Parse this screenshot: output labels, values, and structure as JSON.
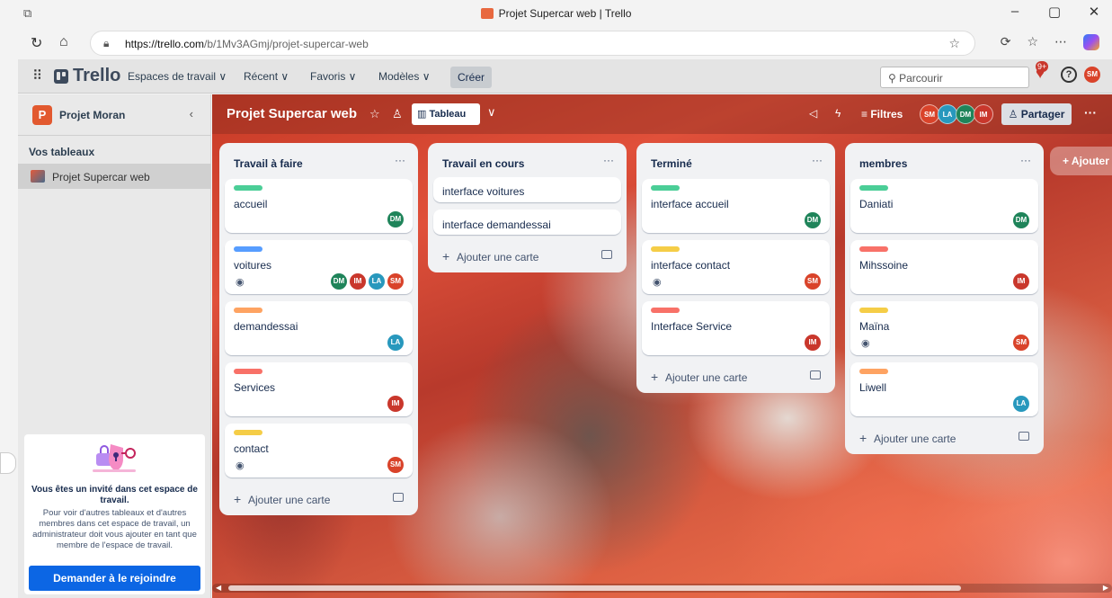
{
  "window": {
    "title": "Projet Supercar web | Trello",
    "minimize": "–",
    "restore": "▢",
    "close": "✕"
  },
  "browser": {
    "url_domain": "https://trello.com",
    "url_path": "/b/1Mv3AGmj/projet-supercar-web"
  },
  "header": {
    "logo": "Trello",
    "menus": [
      "Espaces de travail ∨",
      "Récent ∨",
      "Favoris ∨",
      "Modèles ∨"
    ],
    "create": "Créer",
    "search_placeholder": "Parcourir",
    "notif_count": "9+",
    "user_initials": "SM"
  },
  "sidebar": {
    "workspace_initial": "P",
    "workspace_name": "Projet Moran",
    "section": "Vos tableaux",
    "board": "Projet Supercar web",
    "invite": {
      "title": "Vous êtes un invité dans cet espace de travail.",
      "text": "Pour voir d'autres tableaux et d'autres membres dans cet espace de travail, un administrateur doit vous ajouter en tant que membre de l'espace de travail.",
      "button": "Demander à le rejoindre"
    }
  },
  "board": {
    "title": "Projet Supercar web",
    "view": "Tableau",
    "filters": "Filtres",
    "members": [
      "SM",
      "LA",
      "DM",
      "IM"
    ],
    "share": "Partager",
    "add_list": "+ Ajouter",
    "add_card": "Ajouter une carte",
    "lists": [
      {
        "title": "Travail à faire",
        "cards": [
          {
            "title": "accueil",
            "label": "#4bce97",
            "members": [
              "DM"
            ],
            "watch": false
          },
          {
            "title": "voitures",
            "label": "#579dff",
            "members": [
              "DM",
              "IM",
              "LA",
              "SM"
            ],
            "watch": true
          },
          {
            "title": "demandessai",
            "label": "#fea362",
            "members": [
              "LA"
            ],
            "watch": false
          },
          {
            "title": "Services",
            "label": "#f87168",
            "members": [
              "IM"
            ],
            "watch": false
          },
          {
            "title": "contact",
            "label": "#f5cd47",
            "members": [
              "SM"
            ],
            "watch": true
          }
        ]
      },
      {
        "title": "Travail en cours",
        "cards": [
          {
            "title": "interface voitures"
          },
          {
            "title": "interface demandessai"
          }
        ]
      },
      {
        "title": "Terminé",
        "cards": [
          {
            "title": "interface accueil",
            "label": "#4bce97",
            "members": [
              "DM"
            ],
            "watch": false
          },
          {
            "title": "interface contact",
            "label": "#f5cd47",
            "members": [
              "SM"
            ],
            "watch": true
          },
          {
            "title": "Interface Service",
            "label": "#f87168",
            "members": [
              "IM"
            ],
            "watch": false
          }
        ]
      },
      {
        "title": "membres",
        "cards": [
          {
            "title": "Daniati",
            "label": "#4bce97",
            "members": [
              "DM"
            ],
            "watch": false
          },
          {
            "title": "Mihssoine",
            "label": "#f87168",
            "members": [
              "IM"
            ],
            "watch": false
          },
          {
            "title": "Maïna",
            "label": "#f5cd47",
            "members": [
              "SM"
            ],
            "watch": true
          },
          {
            "title": "Liwell",
            "label": "#fea362",
            "members": [
              "LA"
            ],
            "watch": false
          }
        ]
      }
    ]
  }
}
